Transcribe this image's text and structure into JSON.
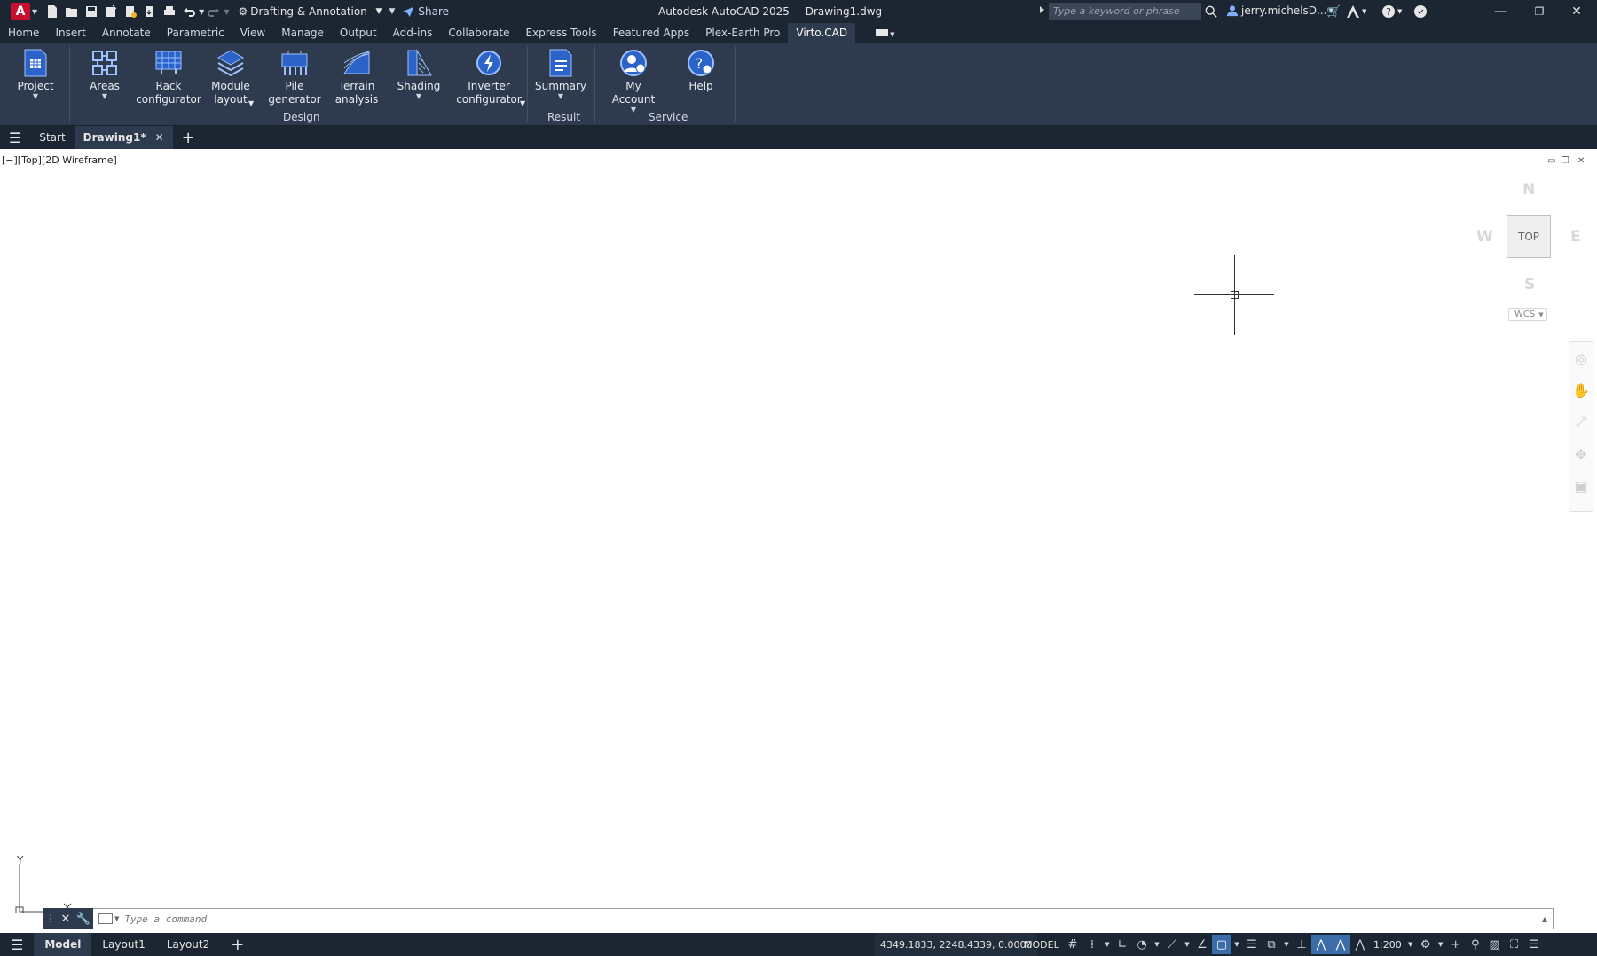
{
  "titlebar": {
    "app_logo": "A",
    "workspace": "Drafting & Annotation",
    "share_label": "Share",
    "app_name": "Autodesk AutoCAD 2025",
    "file_name": "Drawing1.dwg",
    "search_placeholder": "Type a keyword or phrase",
    "user": "jerry.michelsD..."
  },
  "ribbon_tabs": [
    "Home",
    "Insert",
    "Annotate",
    "Parametric",
    "View",
    "Manage",
    "Output",
    "Add-ins",
    "Collaborate",
    "Express Tools",
    "Featured Apps",
    "Plex-Earth Pro",
    "Virto.CAD"
  ],
  "ribbon": {
    "buttons": [
      {
        "label1": "Project",
        "label2": "",
        "caret": true
      },
      {
        "label1": "Areas",
        "label2": "",
        "caret": true
      },
      {
        "label1": "Rack",
        "label2": "configurator",
        "caret": false
      },
      {
        "label1": "Module",
        "label2": "layout",
        "caret": true
      },
      {
        "label1": "Pile",
        "label2": "generator",
        "caret": false
      },
      {
        "label1": "Terrain",
        "label2": "analysis",
        "caret": false
      },
      {
        "label1": "Shading",
        "label2": "",
        "caret": true
      },
      {
        "label1": "Inverter",
        "label2": "configurator",
        "caret": true
      },
      {
        "label1": "Summary",
        "label2": "",
        "caret": true
      },
      {
        "label1": "My Account",
        "label2": "",
        "caret": true
      },
      {
        "label1": "Help",
        "label2": "",
        "caret": false
      }
    ],
    "panels": {
      "design": "Design",
      "result": "Result",
      "service": "Service"
    }
  },
  "file_tabs": {
    "start": "Start",
    "drawing": "Drawing1*"
  },
  "viewport": {
    "label": "[−][Top][2D Wireframe]",
    "compass": {
      "n": "N",
      "s": "S",
      "e": "E",
      "w": "W"
    },
    "cube_face": "TOP",
    "wcs": "WCS",
    "ucs_y": "Y"
  },
  "command": {
    "placeholder": "Type a command"
  },
  "status": {
    "tabs": [
      "Model",
      "Layout1",
      "Layout2"
    ],
    "coords": "4349.1833, 2248.4339, 0.0000",
    "model": "MODEL",
    "scale": "1:200"
  },
  "colors": {
    "dark": "#1c2633",
    "ribbon": "#2e3a4d",
    "accent": "#3b6ea8",
    "icon_blue": "#2b63c9"
  }
}
